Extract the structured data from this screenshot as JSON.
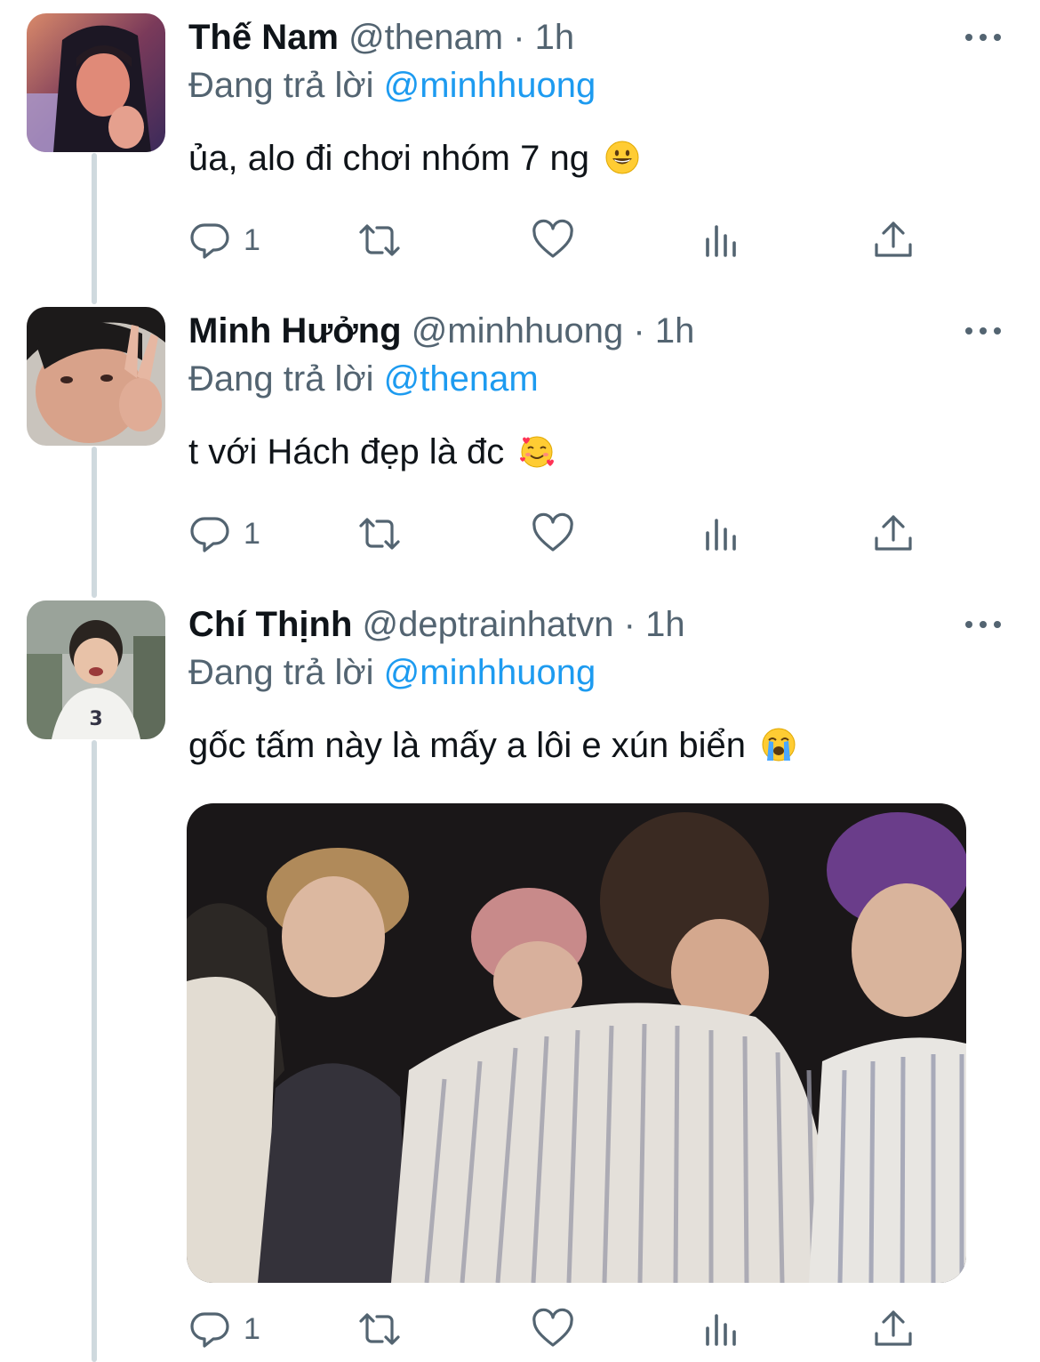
{
  "tweets": [
    {
      "name": "Thế Nam",
      "handle": "@thenam",
      "separator": "·",
      "time": "1h",
      "reply_prefix": "Đang trả lời",
      "reply_to": "@minhhuong",
      "text": "ủa, alo đi chơi nhóm 7 ng",
      "emoji": "grinning-face",
      "reply_count": "1"
    },
    {
      "name": "Minh Hưởng",
      "handle": "@minhhuong",
      "separator": "·",
      "time": "1h",
      "reply_prefix": "Đang trả lời",
      "reply_to": "@thenam",
      "text": "t với Hách đẹp là đc",
      "emoji": "smiling-face-with-hearts",
      "reply_count": "1"
    },
    {
      "name": "Chí Thịnh",
      "handle": "@deptrainhatvn",
      "separator": "·",
      "time": "1h",
      "reply_prefix": "Đang trả lời",
      "reply_to": "@minhhuong",
      "text": "gốc tấm này là mấy a lôi e xún biển",
      "emoji": "loudly-crying-face",
      "reply_count": "1",
      "has_media": true
    }
  ],
  "colors": {
    "text": "#0f1419",
    "secondary": "#536471",
    "accent": "#1d9bf0",
    "thread_line": "#cfd9de"
  },
  "icons": [
    "reply-icon",
    "retweet-icon",
    "like-icon",
    "analytics-icon",
    "share-icon",
    "more-icon"
  ]
}
